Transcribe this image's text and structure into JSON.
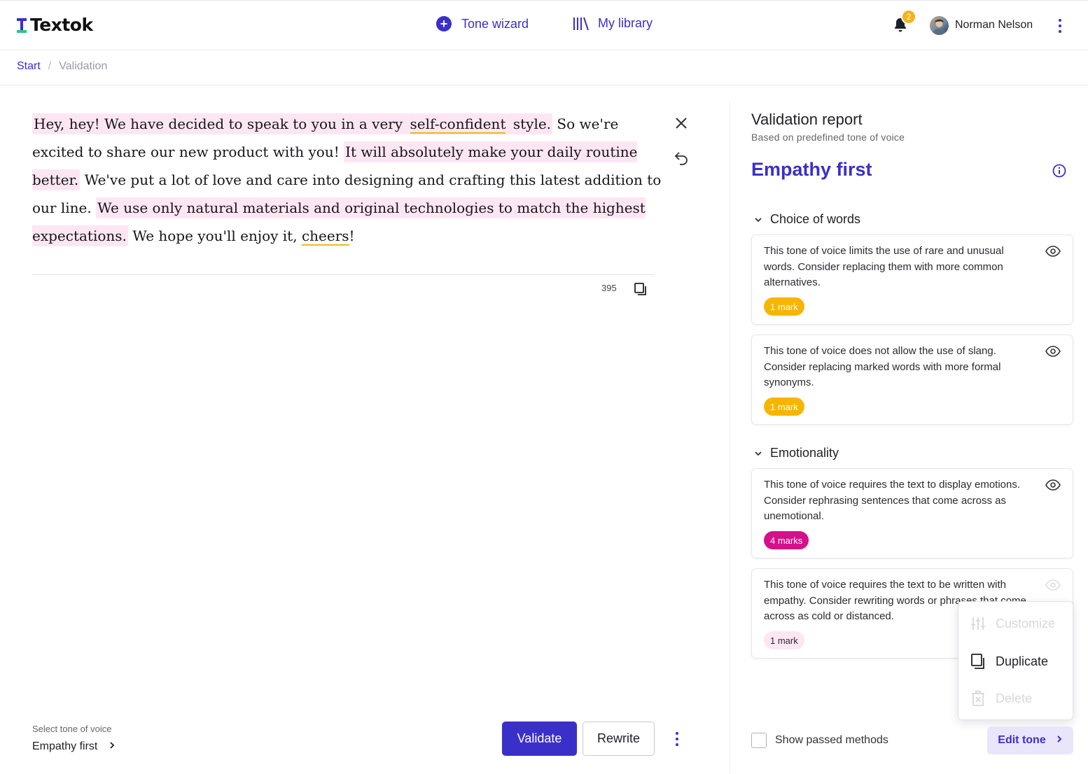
{
  "app": {
    "name": "Textok"
  },
  "nav": {
    "tone_wizard": "Tone wizard",
    "my_library": "My library"
  },
  "user": {
    "name": "Norman Nelson",
    "notifications": "2"
  },
  "breadcrumb": {
    "start": "Start",
    "separator": "/",
    "current": "Validation"
  },
  "editor": {
    "segments": [
      {
        "text": "Hey, hey! We have decided to speak to you in a very ",
        "highlight": true
      },
      {
        "text": "self-confident",
        "highlight": true,
        "underline": true
      },
      {
        "text": " style.",
        "highlight": true
      },
      {
        "text": " So we're excited to  share our new product with you! ",
        "highlight": false
      },
      {
        "text": "It will absolutely make your daily routine better.",
        "highlight": true
      },
      {
        "text": " We've put a lot of love and care into designing and crafting this latest addition to our line. ",
        "highlight": false
      },
      {
        "text": "We use only natural materials and original technologies to match the highest expectations.",
        "highlight": true
      },
      {
        "text": " We hope you'll enjoy it, ",
        "highlight": false
      },
      {
        "text": "cheers",
        "highlight": false,
        "underline": true
      },
      {
        "text": "!",
        "highlight": false
      }
    ],
    "char_count": "395"
  },
  "footer": {
    "select_label": "Select tone of voice",
    "select_value": "Empathy first",
    "validate": "Validate",
    "rewrite": "Rewrite"
  },
  "report": {
    "title": "Validation report",
    "subtitle": "Based on predefined tone of voice",
    "tone_name": "Empathy first",
    "sections": [
      {
        "title": "Choice of words",
        "cards": [
          {
            "text": "This tone of voice limits the use of rare and unusual words. Consider replacing them with more common alternatives.",
            "marks": "1 mark",
            "mark_color": "yellow"
          },
          {
            "text": "This tone of voice does not allow the use of slang. Consider replacing marked words with more formal synonyms.",
            "marks": "1 mark",
            "mark_color": "yellow"
          }
        ]
      },
      {
        "title": "Emotionality",
        "cards": [
          {
            "text": "This tone of voice requires the text to display emotions. Consider rephrasing sentences that come across as unemotional.",
            "marks": "4 marks",
            "mark_color": "magenta"
          },
          {
            "text": "This tone of voice requires the text to be written with empathy. Consider rewriting words or phrases that come across as cold or distanced.",
            "marks": "1 mark",
            "mark_color": "pink"
          }
        ]
      }
    ],
    "show_passed": "Show passed methods",
    "edit_tone": "Edit tone"
  },
  "dropdown": {
    "customize": "Customize",
    "duplicate": "Duplicate",
    "delete": "Delete"
  },
  "colors": {
    "accent": "#3b2fc9",
    "highlight": "#fde6f3",
    "underline": "#f2b81a",
    "mark_yellow": "#f7b500",
    "mark_magenta": "#d4118a"
  }
}
